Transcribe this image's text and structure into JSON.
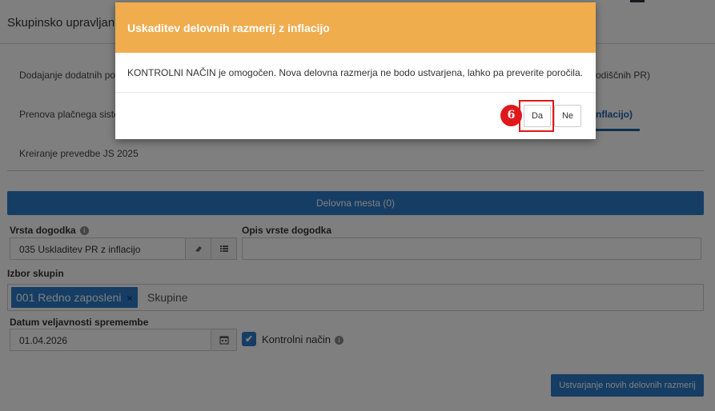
{
  "header": {
    "title": "Skupinsko upravljan"
  },
  "tabs": [
    {
      "label": "Dodajanje dodatnih po"
    },
    {
      "label": "odiščnih PR)"
    },
    {
      "label": "Prenova plačnega siste"
    },
    {
      "label": "nflacijo)"
    },
    {
      "label": "Kreiranje prevedbe JS 2025"
    }
  ],
  "panel": {
    "title": "Delovna mesta (0)"
  },
  "form": {
    "event_type_label": "Vrsta dogodka",
    "event_type_value": "035 Uskladitev PR z inflacijo",
    "event_desc_label": "Opis vrste dogodka",
    "event_desc_value": "",
    "groups_label": "Izbor skupin",
    "group_tag": "001 Redno zaposleni",
    "group_tag_remove": "×",
    "groups_placeholder": "Skupine",
    "date_label": "Datum veljavnosti spremembe",
    "date_value": "01.04.2026",
    "control_mode_label": "Kontrolni način",
    "control_mode_checked": true,
    "create_button": "Ustvarjanje novih delovnih razmerij"
  },
  "icons": {
    "info": "i",
    "eraser": "eraser-icon",
    "list": "list-icon",
    "calendar": "calendar-icon",
    "check": "✔"
  },
  "modal": {
    "title": "Uskaditev delovnih razmerij z inflacijo",
    "body": "KONTROLNI NAČIN je omogočen. Nova delovna razmerja ne bodo ustvarjena, lahko pa preverite poročila.",
    "yes_button": "Da",
    "no_button": "Ne",
    "step_number": "6"
  },
  "colors": {
    "primary": "#2c7bc9",
    "modal_header": "#f0ad4e",
    "highlight": "#e0181b",
    "active_tab": "#1d63a9"
  }
}
